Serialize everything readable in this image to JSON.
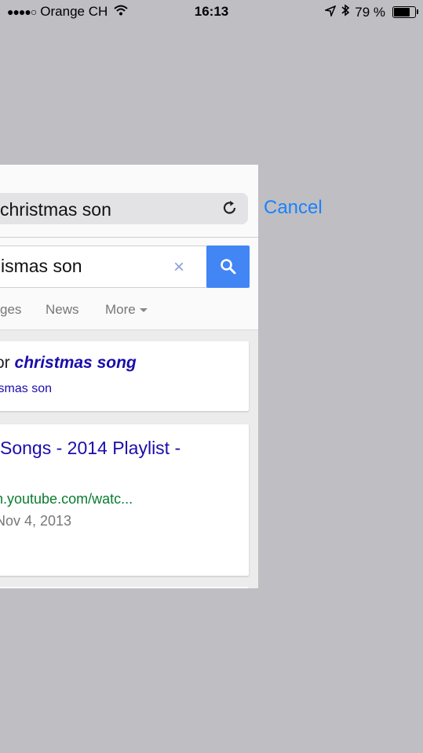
{
  "status_bar": {
    "signal": "●●●●○",
    "carrier": "Orange CH",
    "time": "16:13",
    "battery_percent": "79 %",
    "battery_level": 0.79,
    "icons": [
      "wifi-icon",
      "location-arrow-icon",
      "bluetooth-icon",
      "battery-icon"
    ]
  },
  "address_bar": {
    "text": "christmas son",
    "reload_icon": "reload-icon"
  },
  "cancel_label": "Cancel",
  "google_search": {
    "query": "ismas son",
    "clear_icon": "×",
    "search_icon": "search-icon"
  },
  "tabs": [
    {
      "label": "ges"
    },
    {
      "label": "News"
    },
    {
      "label": "More"
    }
  ],
  "results": {
    "did_you_mean": {
      "prefix": "or ",
      "suggestion": "christmas song",
      "search_instead": "ismas son"
    },
    "first": {
      "title": "Songs - 2014 Playlist -",
      "url": "n.youtube.com/watc...",
      "date": "Nov 4, 2013"
    }
  },
  "colors": {
    "background": "#bfbec3",
    "link_blue": "#1a0dab",
    "ios_blue": "#1a82fb",
    "google_blue": "#4285f4",
    "url_green": "#0a7c2f"
  }
}
